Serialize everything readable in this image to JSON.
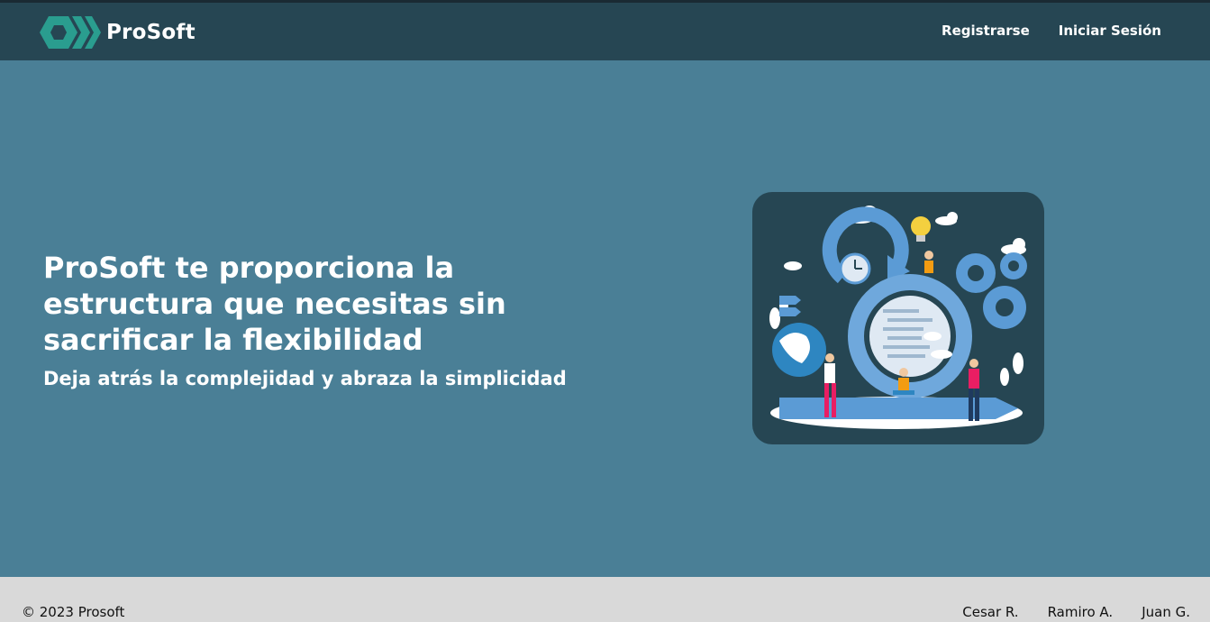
{
  "brand": {
    "name": "ProSoft",
    "logo_icon": "hexagon-chevrons-icon",
    "logo_color": "#2a9d8f"
  },
  "nav": {
    "register": "Registrarse",
    "login": "Iniciar Sesión"
  },
  "hero": {
    "title": "ProSoft te proporciona la estructura que necesitas sin sacrificar la flexibilidad",
    "subtitle": "Deja atrás la complejidad y abraza la simplicidad"
  },
  "footer": {
    "copyright": "© 2023 Prosoft",
    "authors": [
      "Cesar R.",
      "Ramiro A.",
      "Juan G."
    ]
  },
  "colors": {
    "navbar": "#264653",
    "hero_bg": "#4a7f96",
    "footer_bg": "#d9d9d9",
    "accent": "#2a9d8f"
  }
}
